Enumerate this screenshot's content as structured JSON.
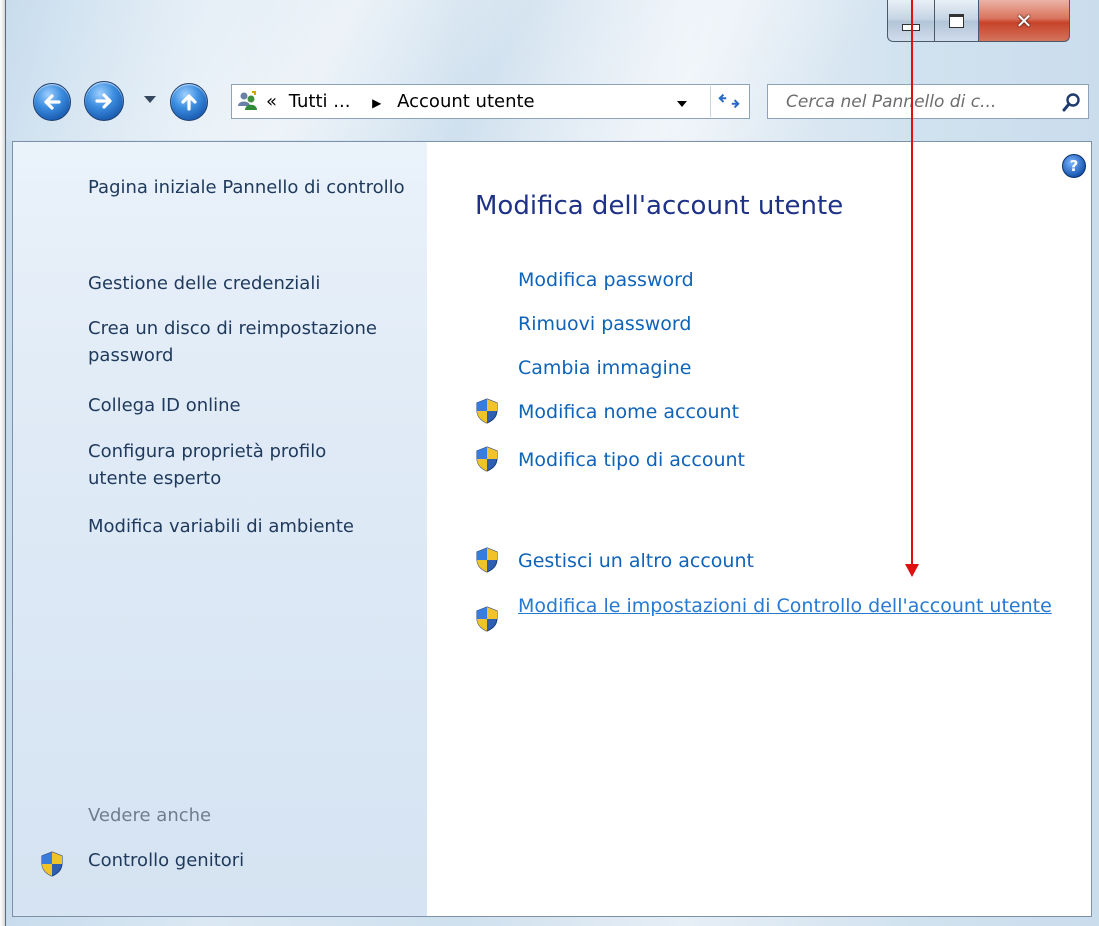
{
  "toolbar": {
    "breadcrumb_prefix": "«",
    "breadcrumb_parent": "Tutti ...",
    "breadcrumb_separator": "▶",
    "breadcrumb_current": "Account utente",
    "search_placeholder": "Cerca nel Pannello di c..."
  },
  "sidebar": {
    "items": [
      {
        "label": "Pagina iniziale Pannello di controllo"
      },
      {
        "label": "Gestione delle credenziali"
      },
      {
        "label": "Crea un disco di reimpostazione password"
      },
      {
        "label": "Collega ID online"
      },
      {
        "label": "Configura proprietà profilo utente esperto"
      },
      {
        "label": "Modifica variabili di ambiente"
      }
    ],
    "see_also_title": "Vedere anche",
    "see_also_items": [
      {
        "label": "Controllo genitori"
      }
    ]
  },
  "main": {
    "title": "Modifica dell'account utente",
    "tasks": [
      {
        "label": "Modifica password"
      },
      {
        "label": "Rimuovi password"
      },
      {
        "label": "Cambia immagine"
      },
      {
        "label": "Modifica nome account"
      },
      {
        "label": "Modifica tipo di account"
      },
      {
        "label": "Gestisci un altro account"
      },
      {
        "label": "Modifica le impostazioni di Controllo dell'account utente"
      }
    ]
  },
  "icons": {
    "back": "back-arrow-icon",
    "forward": "forward-arrow-icon",
    "up": "up-arrow-icon",
    "address": "user-accounts-icon",
    "refresh": "refresh-icon",
    "search": "search-icon",
    "help": "help-icon",
    "shield": "uac-shield-icon"
  },
  "colors": {
    "link": "#0f63b8",
    "title": "#1e3287",
    "annotation_arrow": "#e01010"
  }
}
